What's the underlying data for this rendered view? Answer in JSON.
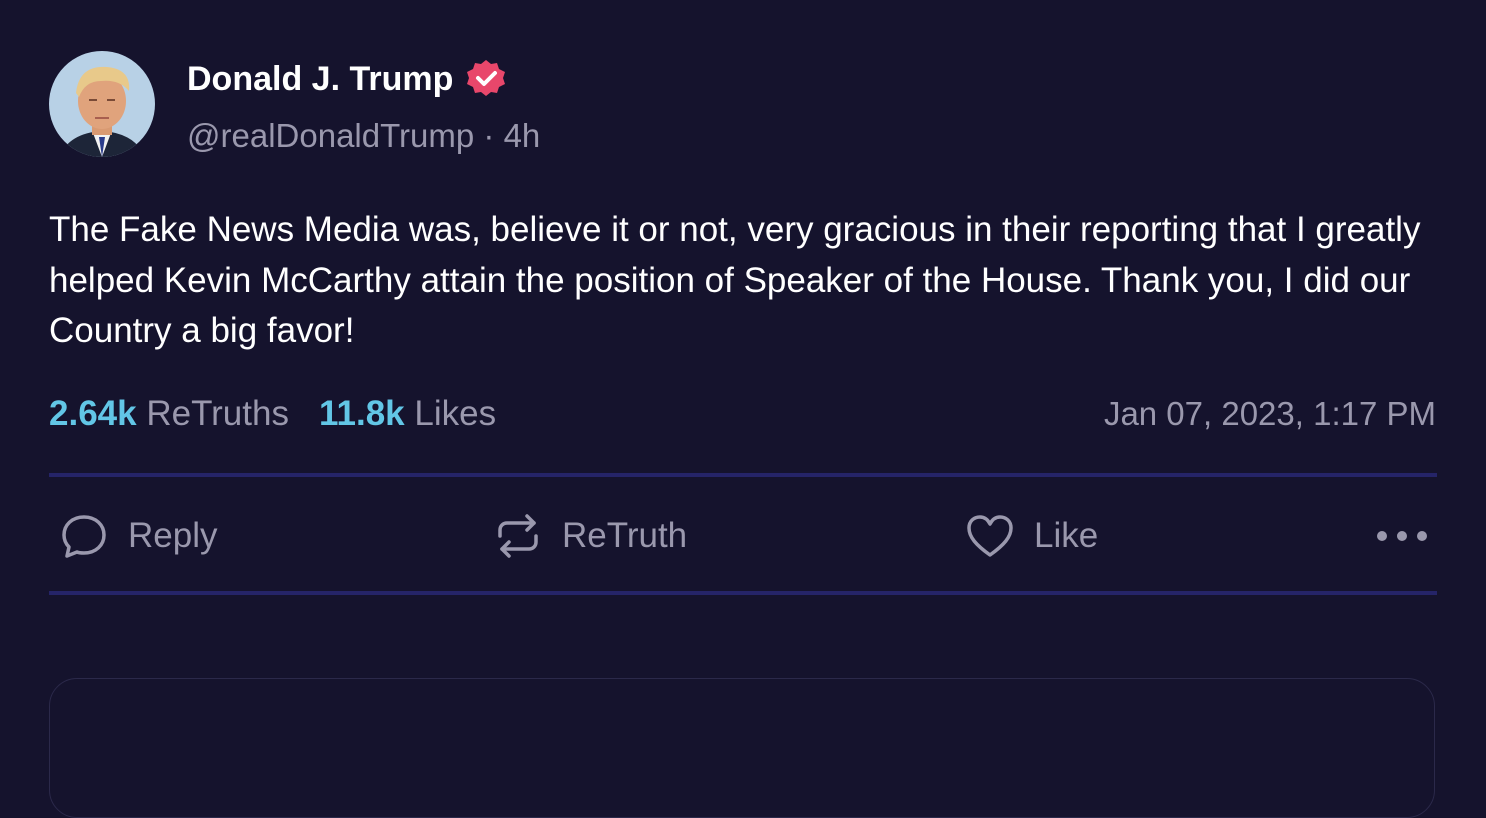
{
  "post": {
    "author": {
      "display_name": "Donald J. Trump",
      "verified_icon": "verified-badge-icon",
      "handle": "@realDonaldTrump",
      "separator": " · ",
      "age": "4h"
    },
    "text": "The Fake News Media was, believe it or not, very gracious in their reporting that I greatly helped Kevin McCarthy attain the position of Speaker of the House. Thank you, I did our Country a big favor!",
    "stats": {
      "retruths_count": "2.64k",
      "retruths_label": "ReTruths",
      "likes_count": "11.8k",
      "likes_label": "Likes"
    },
    "timestamp": "Jan 07, 2023, 1:17 PM"
  },
  "actions": {
    "reply_label": "Reply",
    "reply_icon": "chat-bubble-icon",
    "retruth_label": "ReTruth",
    "retruth_icon": "repost-arrows-icon",
    "like_label": "Like",
    "like_icon": "heart-icon",
    "more_icon": "ellipsis-icon"
  },
  "colors": {
    "background": "#15132d",
    "accent_count": "#62c6e6",
    "muted_text": "#9a98ad",
    "divider": "#252468",
    "verified_badge": "#e8476b"
  }
}
